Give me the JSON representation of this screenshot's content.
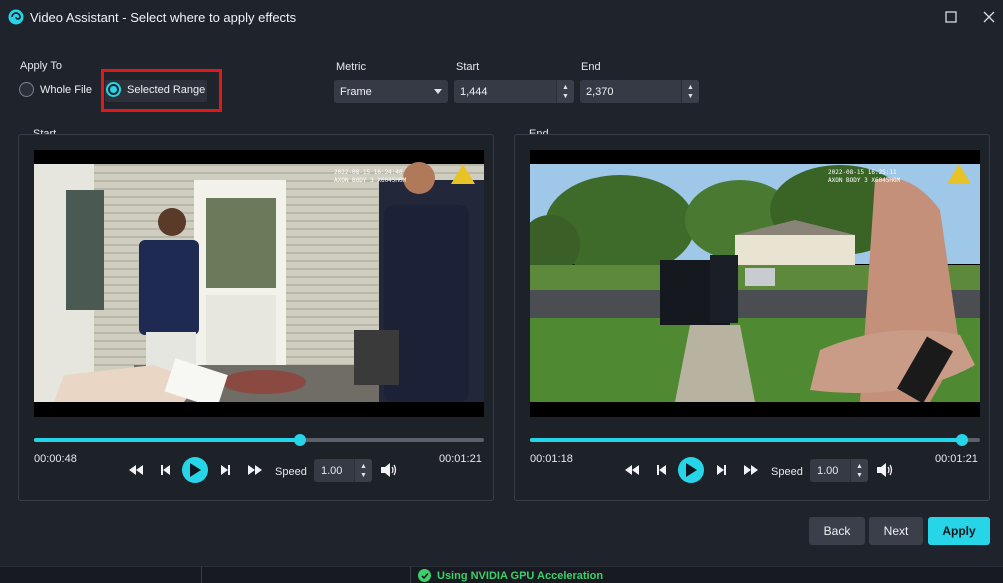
{
  "window": {
    "title": "Video Assistant - Select where to apply effects"
  },
  "apply_to": {
    "label": "Apply To",
    "options": [
      {
        "label": "Whole File",
        "selected": false
      },
      {
        "label": "Selected Range",
        "selected": true
      }
    ]
  },
  "metric": {
    "label": "Metric",
    "value": "Frame"
  },
  "start_field": {
    "label": "Start",
    "value": "1,444"
  },
  "end_field": {
    "label": "End",
    "value": "2,370"
  },
  "start_panel": {
    "label": "Start",
    "current_time": "00:00:48",
    "total_time": "00:01:21",
    "progress": 0.59,
    "speed_label": "Speed",
    "speed": "1.00",
    "overlay": "2022-08-15 16:24:40\nAXON BODY 3 X6045H0M"
  },
  "end_panel": {
    "label": "End",
    "current_time": "00:01:18",
    "total_time": "00:01:21",
    "progress": 0.96,
    "speed_label": "Speed",
    "speed": "1.00",
    "overlay": "2022-08-15 16:25:11\nAXON BODY 3 X6045H0M"
  },
  "buttons": {
    "back": "Back",
    "next": "Next",
    "apply": "Apply"
  },
  "status": {
    "gpu": "Using NVIDIA GPU Acceleration"
  },
  "colors": {
    "accent": "#26d6e8",
    "highlight_box": "#e01818",
    "status_green": "#3fcf6a"
  }
}
